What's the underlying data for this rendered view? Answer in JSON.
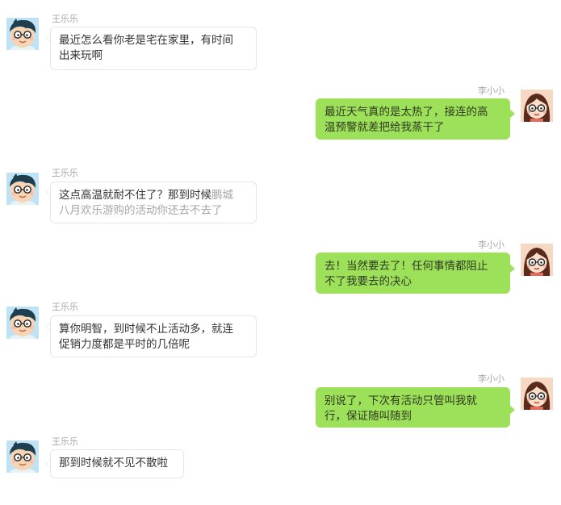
{
  "conversation": {
    "messages": [
      {
        "sender": "王乐乐",
        "side": "left",
        "lines": [
          "最近怎么看你老是宅在家里，有时间",
          "出来玩啊"
        ]
      },
      {
        "sender": "李小小",
        "side": "right",
        "lines": [
          "最近天气真的是太热了，接连的高",
          "温预警就差把给我蒸干了"
        ]
      },
      {
        "sender": "王乐乐",
        "side": "left",
        "lines_a": "这点高温就耐不住了？那到时候",
        "lines_b": "鹏城",
        "lines_c": "八月欢乐游购的活动你还去不去了"
      },
      {
        "sender": "李小小",
        "side": "right",
        "lines": [
          "去！当然要去了！任何事情都阻止",
          "不了我要去的决心"
        ]
      },
      {
        "sender": "王乐乐",
        "side": "left",
        "lines": [
          "算你明智，到时候不止活动多，就连",
          "促销力度都是平时的几倍呢"
        ]
      },
      {
        "sender": "李小小",
        "side": "right",
        "lines": [
          "别说了，下次有活动只管叫我就",
          "行，保证随叫随到"
        ]
      },
      {
        "sender": "王乐乐",
        "side": "left",
        "lines": [
          "那到时候就不见不散啦"
        ]
      }
    ]
  },
  "colors": {
    "right_bubble": "#9de15b",
    "left_bubble": "#ffffff",
    "left_border": "#e6e6e6",
    "name_text": "#a8a8a8",
    "faded_text": "#a6a6a6"
  },
  "icons": {
    "boy_avatar": "boy-avatar-icon",
    "girl_avatar": "girl-avatar-icon"
  }
}
